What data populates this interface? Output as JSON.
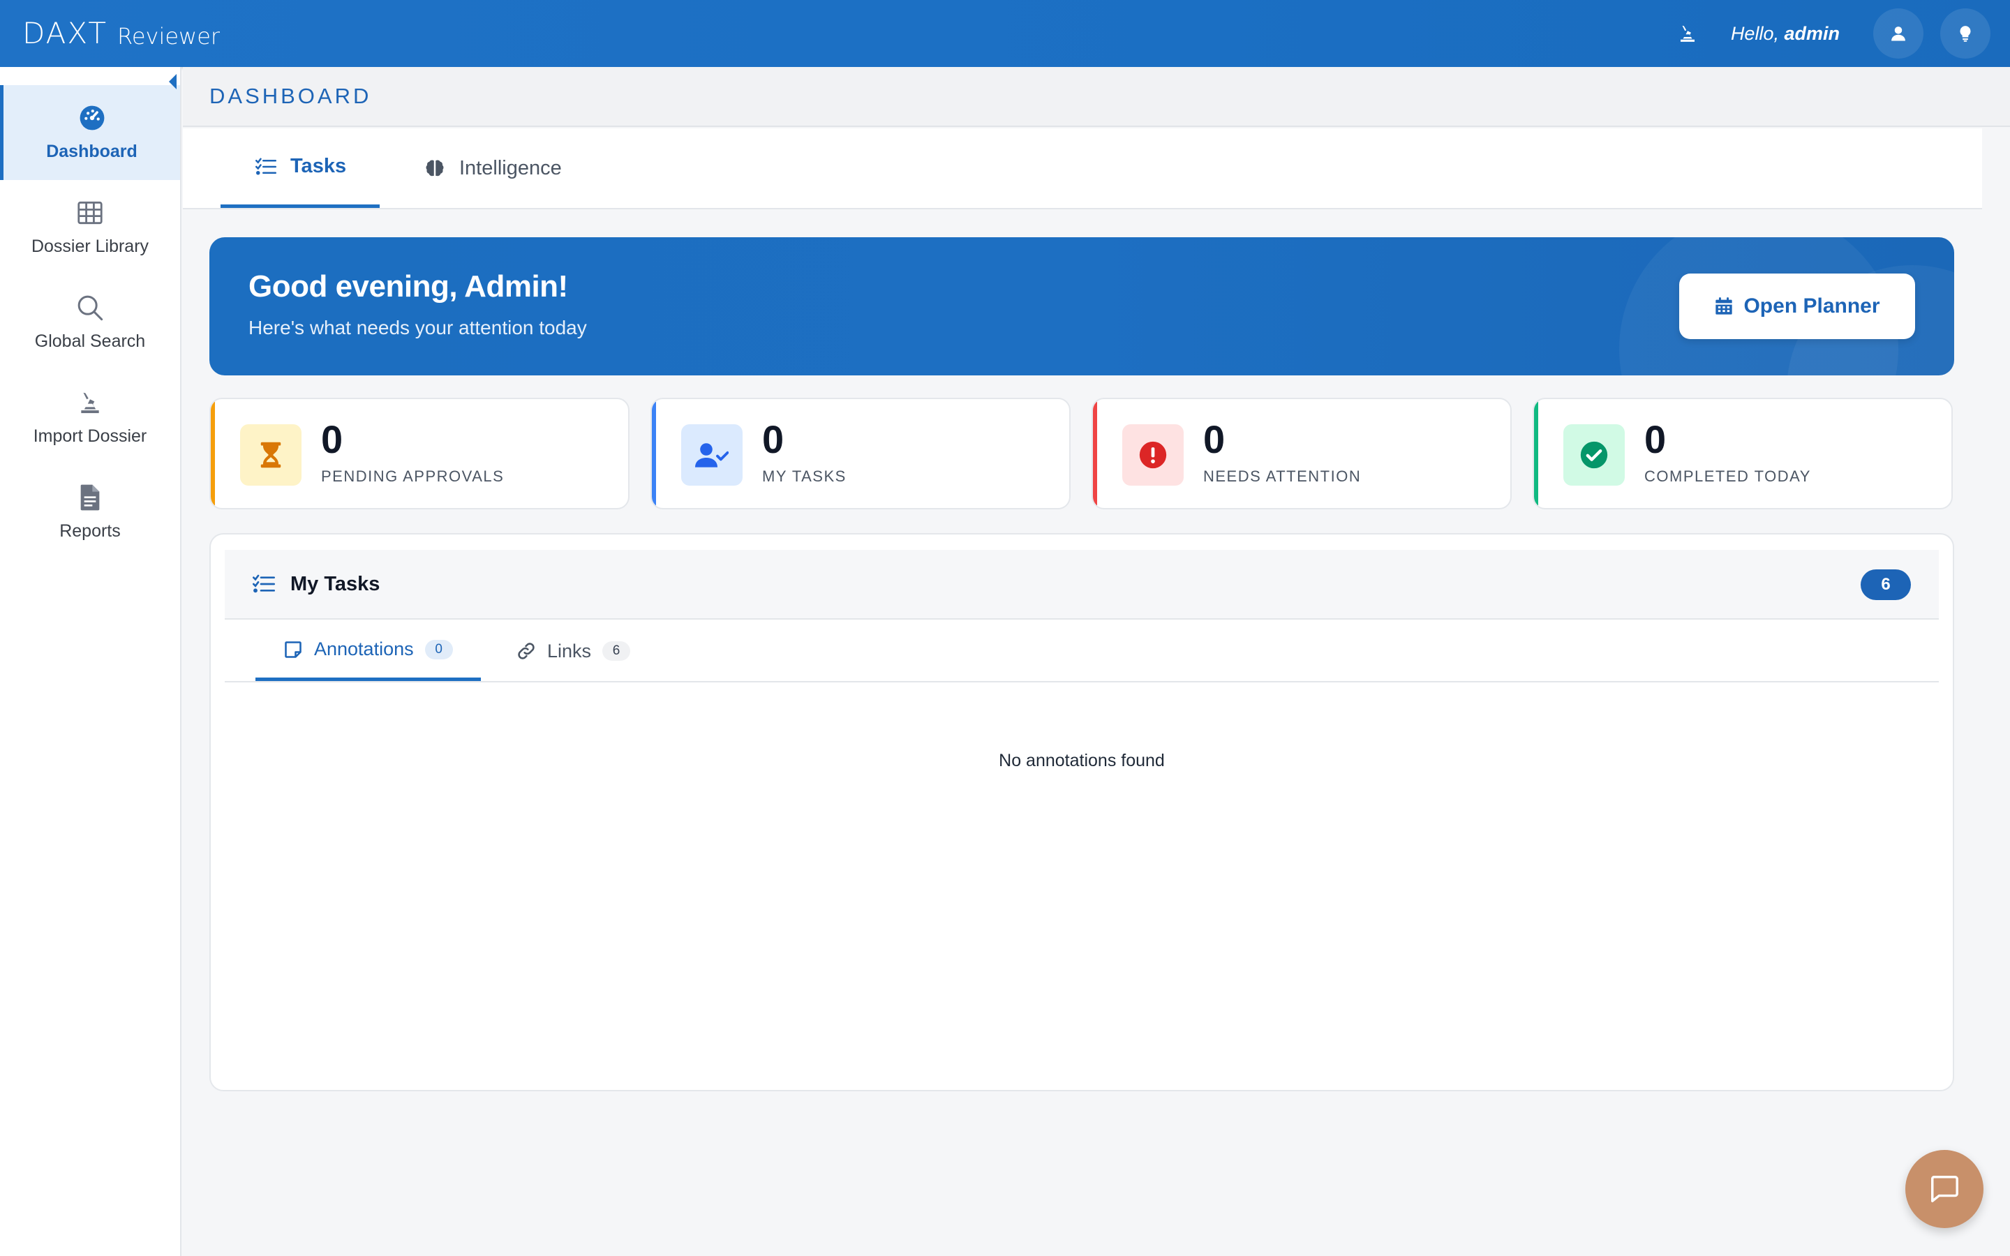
{
  "app": {
    "logo_mark": "DAXT",
    "logo_text": "Reviewer"
  },
  "topbar": {
    "greeting_prefix": "Hello,",
    "user_name": "admin",
    "icons": [
      "import-icon",
      "user-icon",
      "lightbulb-icon"
    ]
  },
  "sidebar": {
    "items": [
      {
        "label": "Dashboard",
        "icon": "dashboard-gauge-icon",
        "active": true
      },
      {
        "label": "Dossier Library",
        "icon": "grid-table-icon"
      },
      {
        "label": "Global Search",
        "icon": "search-icon"
      },
      {
        "label": "Import Dossier",
        "icon": "import-icon"
      },
      {
        "label": "Reports",
        "icon": "document-icon"
      }
    ]
  },
  "page": {
    "title": "DASHBOARD",
    "tabs": [
      {
        "label": "Tasks",
        "icon": "checklist-icon",
        "active": true
      },
      {
        "label": "Intelligence",
        "icon": "brain-icon"
      }
    ]
  },
  "hero": {
    "title": "Good evening, Admin!",
    "subtitle": "Here's what needs your attention today",
    "button_label": "Open Planner",
    "button_icon": "calendar-icon"
  },
  "stats": [
    {
      "value": "0",
      "label": "PENDING APPROVALS",
      "icon": "hourglass-icon",
      "accent": "#f59e0b",
      "tint": "#fef3c7",
      "icon_color": "#d97706"
    },
    {
      "value": "0",
      "label": "MY TASKS",
      "icon": "user-check-icon",
      "accent": "#3b82f6",
      "tint": "#dbeafe",
      "icon_color": "#2563eb"
    },
    {
      "value": "0",
      "label": "NEEDS ATTENTION",
      "icon": "alert-circle-icon",
      "accent": "#ef4444",
      "tint": "#fee2e2",
      "icon_color": "#dc2626"
    },
    {
      "value": "0",
      "label": "COMPLETED TODAY",
      "icon": "check-circle-icon",
      "accent": "#10b981",
      "tint": "#d1fae5",
      "icon_color": "#059669"
    }
  ],
  "tasks_panel": {
    "title": "My Tasks",
    "count": "6",
    "subtabs": [
      {
        "label": "Annotations",
        "count": "0",
        "icon": "note-icon",
        "active": true
      },
      {
        "label": "Links",
        "count": "6",
        "icon": "link-icon"
      }
    ],
    "empty_message": "No annotations found"
  },
  "colors": {
    "brand": "#1d6fc2",
    "active_bg": "#e3eefa",
    "fab": "#c8906a"
  }
}
